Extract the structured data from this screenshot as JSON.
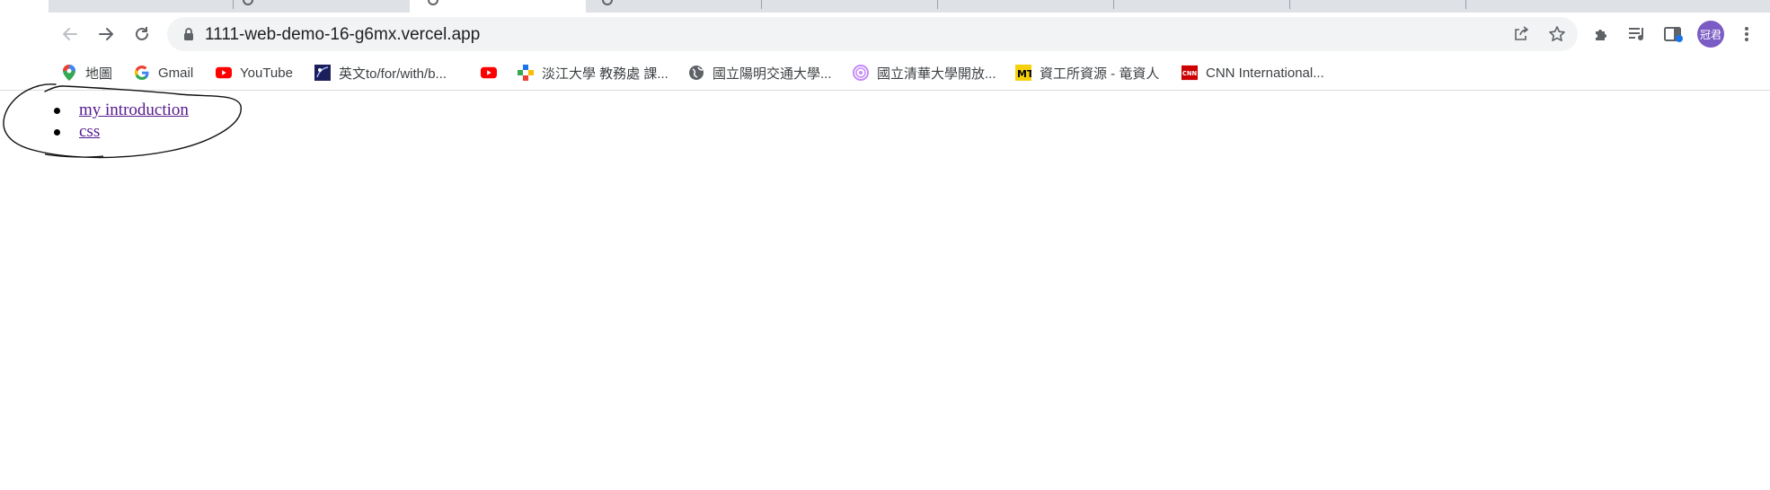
{
  "browser": {
    "url": "1111-web-demo-16-g6mx.vercel.app",
    "profile_initials": "冠君",
    "colors": {
      "avatar": "#7b5cc4",
      "omnibox": "#f1f3f4",
      "link_visited": "#551a8b"
    }
  },
  "bookmarks": [
    {
      "label": "地圖",
      "icon": "maps-pin-icon"
    },
    {
      "label": "Gmail",
      "icon": "google-g-icon"
    },
    {
      "label": "YouTube",
      "icon": "youtube-icon"
    },
    {
      "label": "英文to/for/with/b...",
      "icon": "book-cover-icon"
    },
    {
      "label": "",
      "icon": "youtube-icon"
    },
    {
      "label": "淡江大學 教務處 課...",
      "icon": "tku-logo-icon"
    },
    {
      "label": "國立陽明交通大學...",
      "icon": "globe-icon"
    },
    {
      "label": "國立清華大學開放...",
      "icon": "nthu-logo-icon"
    },
    {
      "label": "資工所資源 - 竜資人",
      "icon": "mt-logo-icon"
    },
    {
      "label": "CNN International...",
      "icon": "cnn-logo-icon"
    }
  ],
  "page": {
    "links": [
      {
        "label": "my introduction"
      },
      {
        "label": "css"
      }
    ]
  }
}
